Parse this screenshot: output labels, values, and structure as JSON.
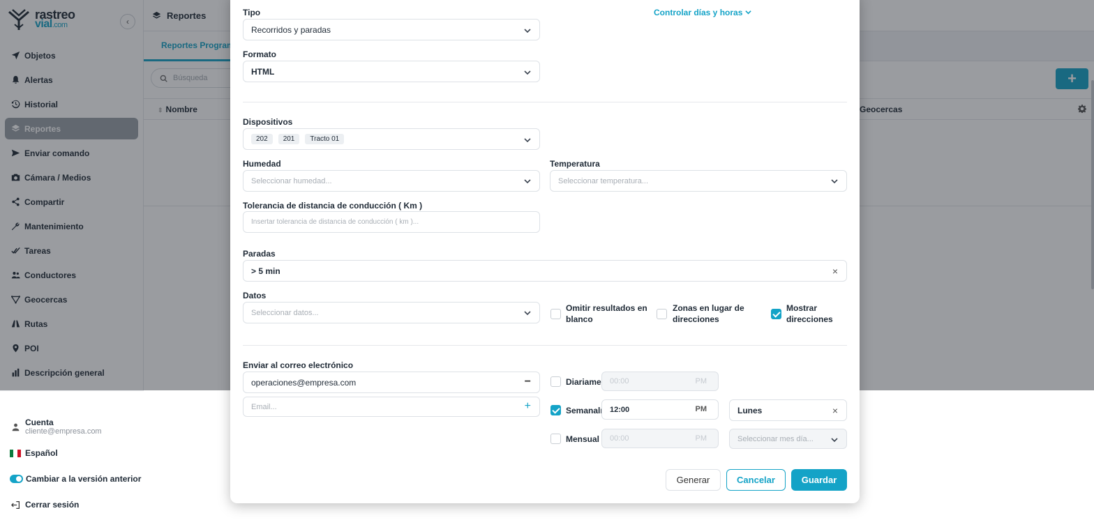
{
  "brand": {
    "name_line1": "rastreo",
    "name_line2": "vial",
    "name_suffix": ".com"
  },
  "sidebar": {
    "items": [
      {
        "label": "Objetos",
        "icon": "location-arrow-icon"
      },
      {
        "label": "Alertas",
        "icon": "bell-icon"
      },
      {
        "label": "Historial",
        "icon": "history-icon"
      },
      {
        "label": "Reportes",
        "icon": "layers-icon",
        "active": true
      },
      {
        "label": "Enviar comando",
        "icon": "send-icon"
      },
      {
        "label": "Cámara / Medios",
        "icon": "camera-icon"
      },
      {
        "label": "Compartir",
        "icon": "share-icon"
      },
      {
        "label": "Mantenimiento",
        "icon": "wrench-icon"
      },
      {
        "label": "Tareas",
        "icon": "check-double-icon"
      },
      {
        "label": "Conductores",
        "icon": "users-icon"
      },
      {
        "label": "Geocercas",
        "icon": "geofence-icon"
      },
      {
        "label": "Rutas",
        "icon": "road-icon"
      },
      {
        "label": "POI",
        "icon": "map-pin-icon"
      },
      {
        "label": "Descripción general",
        "icon": "bar-chart-icon"
      }
    ],
    "account": {
      "label": "Cuenta",
      "email": "cliente@empresa.com"
    },
    "language": "Español",
    "legacy_toggle": "Cambiar a la versión anterior",
    "logout": "Cerrar sesión"
  },
  "page": {
    "title": "Reportes",
    "tab_active": "Reportes Programa",
    "search_placeholder": "Búsqueda",
    "add_label": "+",
    "col_name": "Nombre",
    "col_geofences": "Geocercas"
  },
  "modal": {
    "control_link": "Controlar días y horas",
    "tipo": {
      "label": "Tipo",
      "value": "Recorridos y paradas"
    },
    "formato": {
      "label": "Formato",
      "value": "HTML"
    },
    "dispositivos": {
      "label": "Dispositivos",
      "tags": [
        "202",
        "201",
        "Tracto 01"
      ]
    },
    "humedad": {
      "label": "Humedad",
      "placeholder": "Seleccionar humedad..."
    },
    "temperatura": {
      "label": "Temperatura",
      "placeholder": "Seleccionar temperatura..."
    },
    "tolerancia": {
      "label": "Tolerancia de distancia de conducción ( Km )",
      "placeholder": "Insertar tolerancia de distancia de conducción ( km )..."
    },
    "paradas": {
      "label": "Paradas",
      "value": "> 5 min"
    },
    "datos": {
      "label": "Datos",
      "placeholder": "Seleccionar datos..."
    },
    "checks": {
      "omitir": {
        "label_1": "Omitir resultados en",
        "label_2": "blanco",
        "checked": false
      },
      "zonas": {
        "label_1": "Zonas en lugar de",
        "label_2": "direcciones",
        "checked": false
      },
      "mostrar": {
        "label_1": "Mostrar",
        "label_2": "direcciones",
        "checked": true
      }
    },
    "email": {
      "label": "Enviar al correo electrónico",
      "value": "operaciones@empresa.com",
      "placeholder": "Email...",
      "remove": "−",
      "add": "+"
    },
    "schedule": {
      "daily": {
        "label": "Diariamente",
        "time": "00:00",
        "ampm": "PM",
        "checked": false
      },
      "weekly": {
        "label": "Semanalm",
        "time": "12:00",
        "ampm": "PM",
        "checked": true,
        "day": "Lunes"
      },
      "monthly": {
        "label": "Mensual",
        "time": "00:00",
        "ampm": "PM",
        "checked": false,
        "day_placeholder": "Seleccionar mes día..."
      }
    },
    "buttons": {
      "generate": "Generar",
      "cancel": "Cancelar",
      "save": "Guardar"
    }
  },
  "colors": {
    "accent": "#14a3c7",
    "overlay": "#1e242c"
  }
}
